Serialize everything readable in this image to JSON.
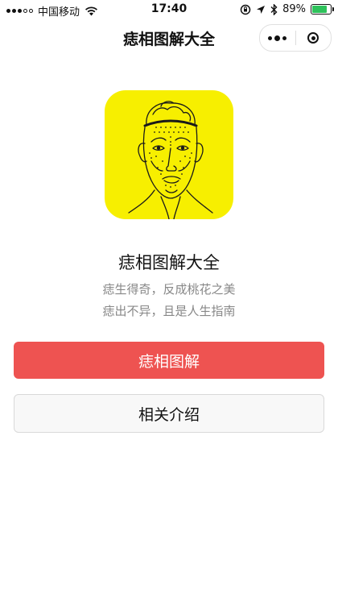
{
  "status_bar": {
    "carrier": "中国移动",
    "time": "17:40",
    "battery_percent": "89%",
    "battery_level": 0.89,
    "battery_color": "#2ec25b"
  },
  "nav": {
    "title": "痣相图解大全"
  },
  "app": {
    "name": "痣相图解大全",
    "tagline_1": "痣生得奇，反成桃花之美",
    "tagline_2": "痣出不异，且是人生指南",
    "logo_bg": "#f7ef00"
  },
  "buttons": {
    "primary_label": "痣相图解",
    "secondary_label": "相关介绍",
    "primary_color": "#ee5351"
  },
  "icons": {
    "wifi": "wifi-icon",
    "lock_rotation": "lock-rotation-icon",
    "location": "location-arrow-icon",
    "bluetooth": "bluetooth-icon",
    "more": "more-dots-icon",
    "close": "target-close-icon"
  }
}
